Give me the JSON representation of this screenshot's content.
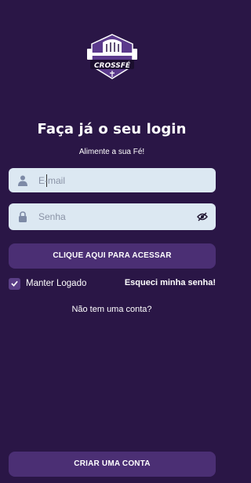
{
  "logo": {
    "icon": "crossfe-logo",
    "text": "CROSSFÉ"
  },
  "header": {
    "title": "Faça já o seu login",
    "subtitle": "Alimente a sua Fé!"
  },
  "form": {
    "email_placeholder": "E-mail",
    "password_placeholder": "Senha",
    "submit_label": "CLIQUE AQUI PARA ACESSAR",
    "remember_label": "Manter Logado",
    "remember_checked": true,
    "forgot_label": "Esqueci minha senha!"
  },
  "footer": {
    "no_account_label": "Não tem uma conta?",
    "create_account_label": "CRIAR UMA CONTA"
  },
  "colors": {
    "background": "#2a1646",
    "button": "#4b2f74",
    "field": "#dce8f2",
    "icon": "#7d8aa6"
  }
}
